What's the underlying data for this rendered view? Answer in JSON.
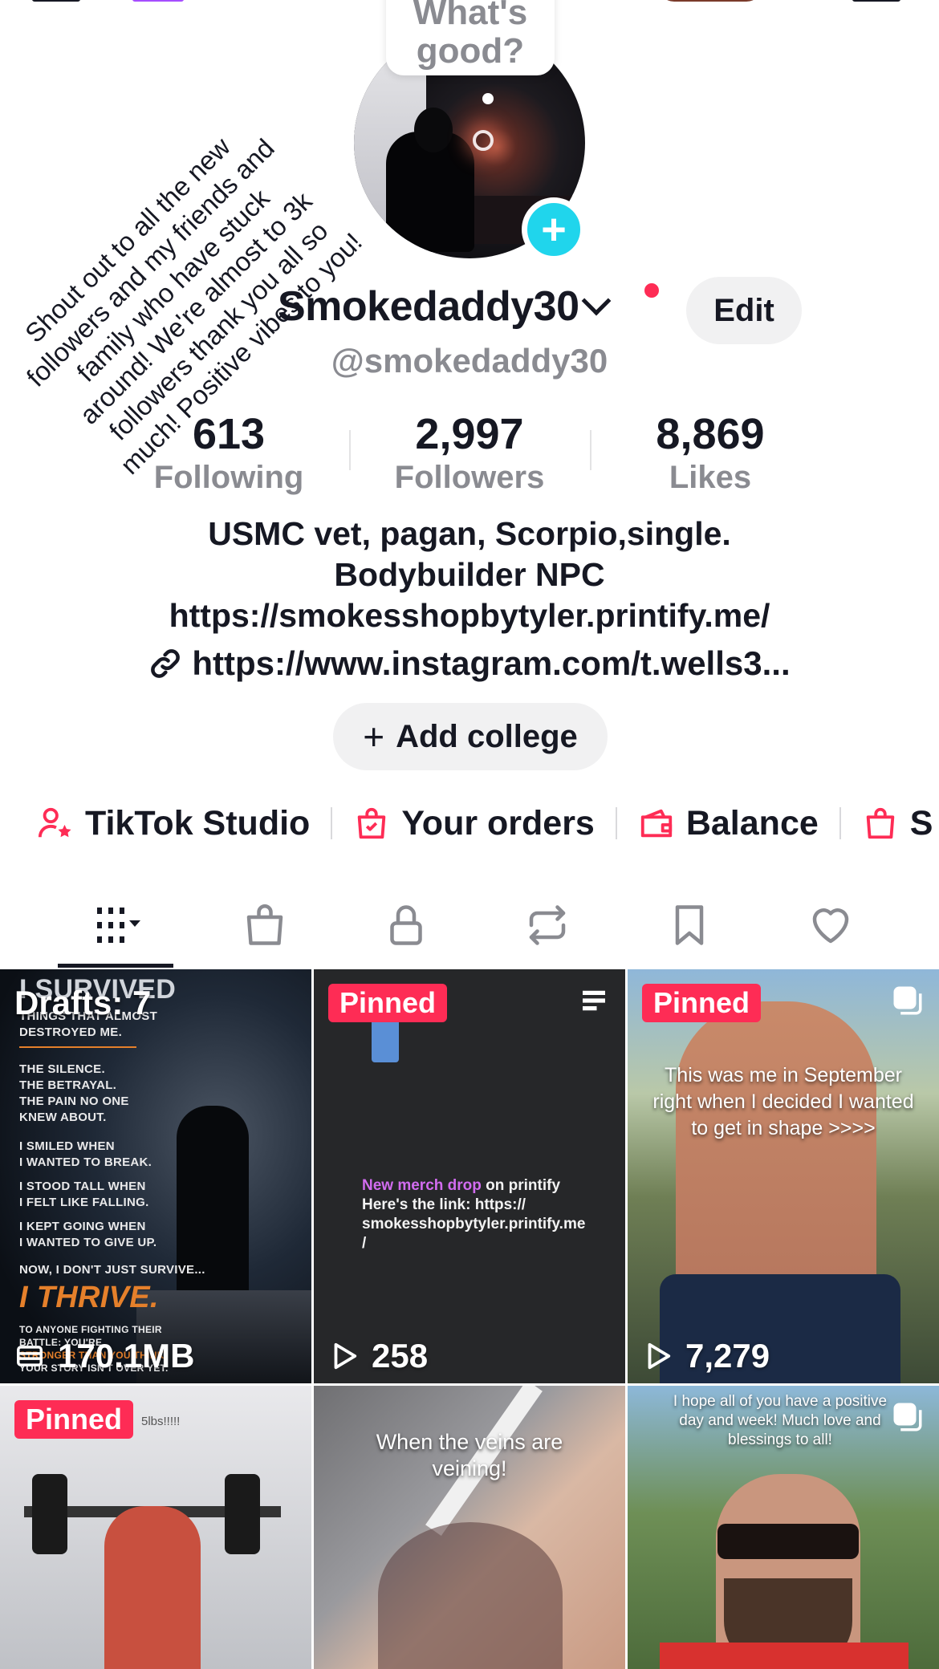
{
  "profile": {
    "bubble_text": "What's good?",
    "shoutout": "Shout out to all the new followers and my friends and family who have stuck around! We're almost to 3k followers thank you all so much! Positive vibes to you!",
    "username": "Smokedaddy30",
    "handle": "@smokedaddy30",
    "edit_label": "Edit",
    "stats": [
      {
        "value": "613",
        "label": "Following"
      },
      {
        "value": "2,997",
        "label": "Followers"
      },
      {
        "value": "8,869",
        "label": "Likes"
      }
    ],
    "bio_lines": [
      "USMC vet, pagan, Scorpio,single.",
      "Bodybuilder NPC",
      "https://smokesshopbytyler.printify.me/"
    ],
    "link": "https://www.instagram.com/t.wells3...",
    "add_college_label": "Add college"
  },
  "shortcuts": [
    {
      "label": "TikTok Studio",
      "icon": "person-star-icon"
    },
    {
      "label": "Your orders",
      "icon": "bag-check-icon"
    },
    {
      "label": "Balance",
      "icon": "wallet-icon"
    },
    {
      "label": "S",
      "icon": "bag-icon"
    }
  ],
  "tabs": [
    "grid-icon",
    "shop-bag-icon",
    "lock-icon",
    "repost-icon",
    "bookmark-icon",
    "heart-icon"
  ],
  "grid": {
    "drafts_label": "Drafts: 7",
    "drafts_size": "170.1MB",
    "pinned_label": "Pinned",
    "poster": {
      "title": "I SURVIVED",
      "lines": [
        "THINGS THAT ALMOST",
        "DESTROYED ME.",
        "THE SILENCE.",
        "THE BETRAYAL.",
        "THE PAIN NO ONE",
        "KNEW ABOUT.",
        "I SMILED WHEN",
        "I WANTED TO BREAK.",
        "I STOOD TALL WHEN",
        "I FELT LIKE FALLING.",
        "I KEPT GOING WHEN",
        "I WANTED TO GIVE UP.",
        "NOW, I DON'T JUST SURVIVE...",
        "I THRIVE.",
        "TO ANYONE FIGHTING THEIR",
        "BATTLE: YOU'RE",
        "STRONGER THAN YOU THINK.",
        "YOUR STORY ISN'T OVER YET."
      ]
    },
    "merch_highlight": "New merch drop",
    "merch_text_1": " on printify",
    "merch_text_2": "Here's the link: https://",
    "merch_text_3": "smokesshopbytyler.printify.me",
    "merch_text_4": "/",
    "merch_views": "258",
    "sept_caption": "This was me in September right when I decided I wanted to get in shape >>>>",
    "sept_views": "7,279",
    "gym_caption": "5lbs!!!!!",
    "veins_caption": "When the veins are veining!",
    "positive_caption": "I hope all of you have a positive day and week! Much love and blessings to all!"
  },
  "colors": {
    "accent": "#fe2c55",
    "teal": "#20d5ec",
    "muted": "#8a8b91"
  }
}
